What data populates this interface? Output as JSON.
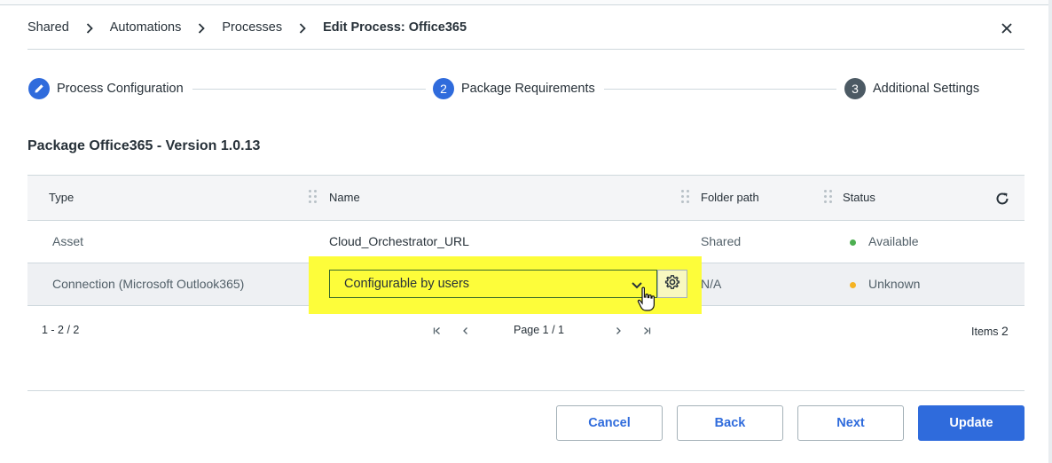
{
  "breadcrumb": {
    "items": [
      "Shared",
      "Automations",
      "Processes"
    ],
    "current": "Edit Process: Office365"
  },
  "stepper": {
    "steps": [
      {
        "number": "",
        "label": "Process Configuration",
        "state": "done"
      },
      {
        "number": "2",
        "label": "Package Requirements",
        "state": "active"
      },
      {
        "number": "3",
        "label": "Additional Settings",
        "state": "todo"
      }
    ]
  },
  "package_title": "Package Office365 - Version 1.0.13",
  "table": {
    "columns": [
      "Type",
      "Name",
      "Folder path",
      "Status"
    ],
    "rows": [
      {
        "type": "Asset",
        "name": "Cloud_Orchestrator_URL",
        "folder": "Shared",
        "status": "Available",
        "status_color": "#4caf50"
      },
      {
        "type": "Connection (Microsoft Outlook365)",
        "name": "Configurable by users",
        "folder": "N/A",
        "status": "Unknown",
        "status_color": "#f5b323"
      }
    ]
  },
  "pagination": {
    "range": "1 - 2 / 2",
    "page": "Page 1 / 1",
    "items_label": "Items",
    "items_count": "2"
  },
  "buttons": {
    "cancel": "Cancel",
    "back": "Back",
    "next": "Next",
    "update": "Update"
  },
  "colors": {
    "accent": "#2f6bdc",
    "highlight": "#fdfd3a"
  }
}
